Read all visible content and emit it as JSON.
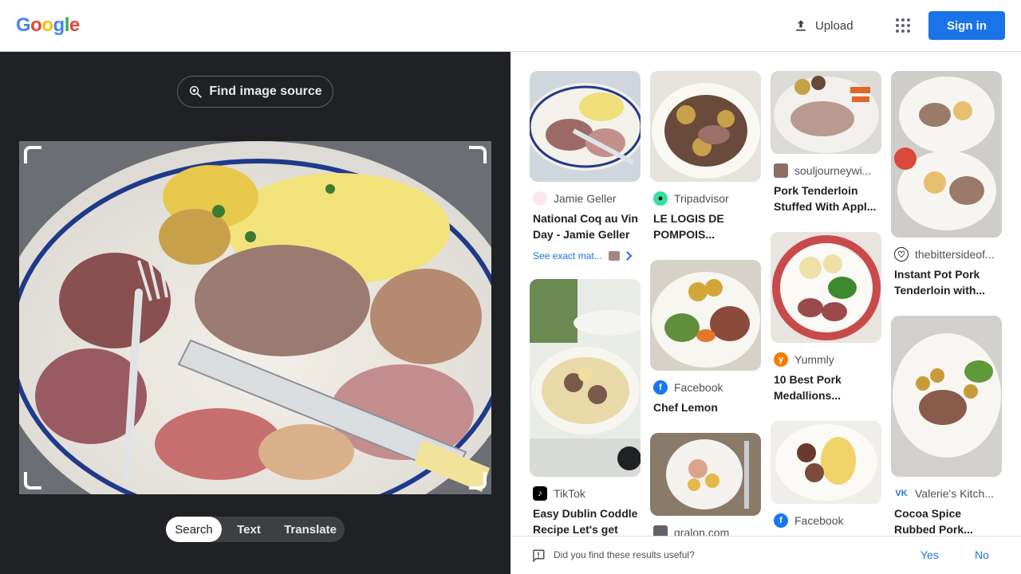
{
  "header": {
    "logo_letters": [
      "G",
      "o",
      "o",
      "g",
      "l",
      "e"
    ],
    "logo_colors": [
      "#4285F4",
      "#EA4335",
      "#FBBC05",
      "#4285F4",
      "#34A853",
      "#EA4335"
    ],
    "upload_label": "Upload",
    "apps_icon": "apps-grid-icon",
    "signin_label": "Sign in"
  },
  "left_panel": {
    "find_source_label": "Find image source",
    "modes": [
      "Search",
      "Text",
      "Translate"
    ],
    "active_mode": "Search"
  },
  "results": {
    "columns": [
      [
        {
          "source": "Jamie Geller",
          "title": "National Coq au Vin Day - Jamie Geller",
          "exact": "See exact mat...",
          "favicon_color": "#f8bbd0"
        },
        {
          "source": "TikTok",
          "title": "Easy Dublin Coddle Recipe Let's get",
          "favicon_color": "#000000"
        }
      ],
      [
        {
          "source": "Tripadvisor",
          "title": "LE LOGIS DE POMPOIS...",
          "favicon_color": "#34e0a1"
        },
        {
          "source": "Facebook",
          "title": "Chef Lemon",
          "favicon_color": "#1877f2"
        },
        {
          "source": "gralon.com",
          "title": "",
          "favicon_color": "#5f6368"
        }
      ],
      [
        {
          "source": "souljourneywi...",
          "title": "Pork Tenderloin Stuffed With Appl...",
          "favicon_color": "#8d6e63"
        },
        {
          "source": "Yummly",
          "title": "10 Best Pork Medallions...",
          "favicon_color": "#f57c00"
        },
        {
          "source": "Facebook",
          "title": "",
          "favicon_color": "#1877f2"
        }
      ],
      [
        {
          "source": "thebittersideof...",
          "title": "Instant Pot Pork Tenderloin with...",
          "favicon_color": "#202124"
        },
        {
          "source": "Valerie's Kitch...",
          "title": "Cocoa Spice Rubbed Pork...",
          "favicon_color": "#1a73e8"
        }
      ]
    ]
  },
  "feedback": {
    "question": "Did you find these results useful?",
    "yes": "Yes",
    "no": "No"
  },
  "colors": {
    "accent": "#1a73e8",
    "dark_panel": "#202124"
  }
}
